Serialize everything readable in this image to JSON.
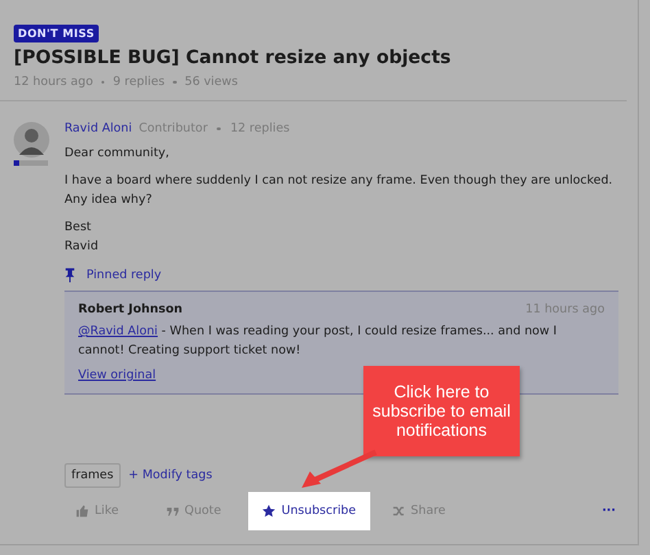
{
  "badge": "DON'T MISS",
  "title": "[POSSIBLE BUG] Cannot resize any objects",
  "meta": [
    "12 hours ago",
    "9 replies",
    "56 views"
  ],
  "post": {
    "author": "Ravid Aloni",
    "role": "Contributor",
    "replies": "12 replies",
    "level": 0.15,
    "paragraphs": [
      "Dear community,",
      "I have a board where suddenly I can not resize any frame. Even though they are unlocked. Any idea why?",
      "Best\nRavid"
    ]
  },
  "pinned": {
    "label": "Pinned reply",
    "author": "Robert Johnson",
    "time": "11 hours ago",
    "mention": "@Ravid Aloni",
    "text": " - When I was reading your post, I could resize frames... and now I cannot! Creating support ticket now!",
    "link": "View original"
  },
  "tags": [
    "frames"
  ],
  "modify_tags": "+ Modify tags",
  "actions": [
    {
      "kind": "like",
      "label": "Like",
      "selected": false
    },
    {
      "kind": "quote",
      "label": "Quote",
      "selected": false
    },
    {
      "kind": "subscribe",
      "label": "Unsubscribe",
      "selected": true
    },
    {
      "kind": "share",
      "label": "Share",
      "selected": false
    },
    {
      "kind": "more",
      "label": "···",
      "selected": false
    }
  ],
  "callout": "Click here to subscribe to email notifications"
}
